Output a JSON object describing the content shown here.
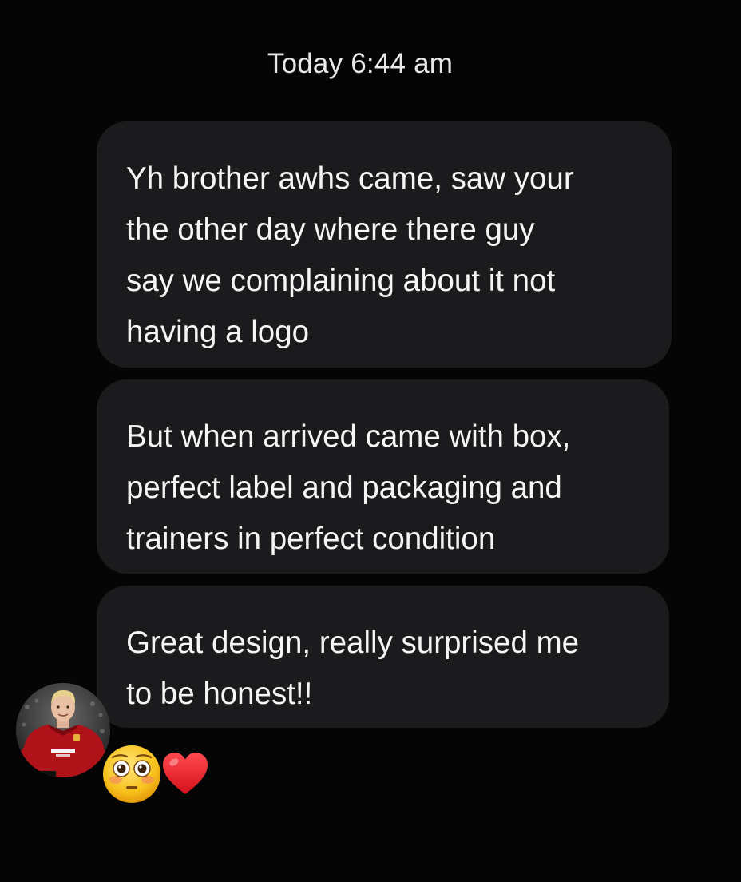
{
  "thread": {
    "timestamp": "Today 6:44 am"
  },
  "messages": [
    {
      "text": "Yh brother awhs came, saw your\nthe other day where there guy\nsay we complaining about it not\nhaving a logo"
    },
    {
      "text": "But when arrived came with box,\nperfect label and packaging and\ntrainers in perfect condition"
    },
    {
      "text": "Great design, really surprised me\nto be honest!!"
    }
  ],
  "sender": {
    "avatar_icon": "avatar-footballer-photo"
  },
  "reactions": [
    {
      "icon": "flushed-face-icon"
    },
    {
      "icon": "red-heart-icon",
      "color": "#e8202a"
    }
  ],
  "colors": {
    "background": "#050505",
    "bubble": "#1b1b1d",
    "text": "#f5f5f5"
  }
}
